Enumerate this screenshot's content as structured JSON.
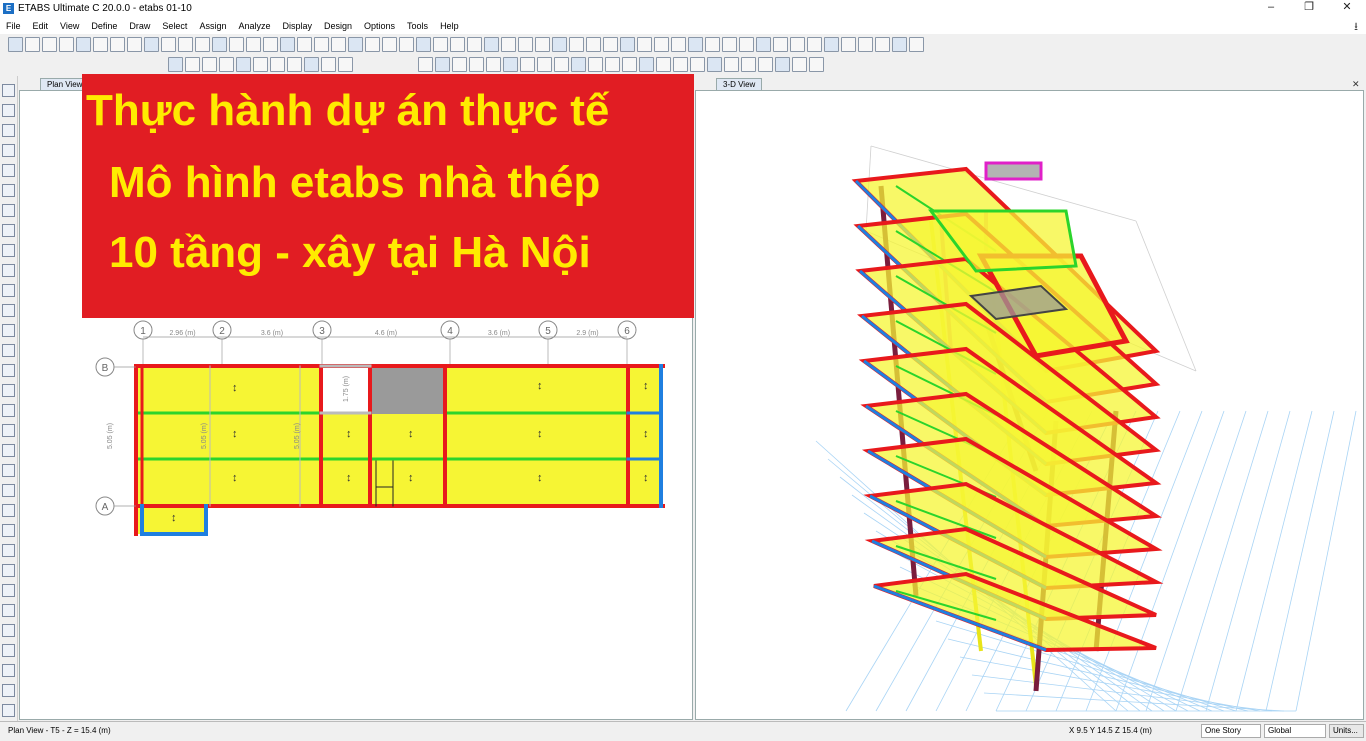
{
  "window": {
    "title": "ETABS Ultimate C 20.0.0 - etabs 01-10",
    "icon": "etabs-logo",
    "minimize": "–",
    "restore": "❐",
    "close": "✕"
  },
  "menu": [
    "File",
    "Edit",
    "View",
    "Define",
    "Draw",
    "Select",
    "Assign",
    "Analyze",
    "Display",
    "Design",
    "Options",
    "Tools",
    "Help"
  ],
  "download_icon": "⭳",
  "left_tab": "Plan View",
  "right_tab": "3-D View",
  "close_glyph": "✕",
  "banner": {
    "line1": "Thực hành dự án thực tế",
    "line2": "Mô hình etabs nhà thép",
    "line3": "10 tầng - xây tại Hà Nội"
  },
  "plan": {
    "grid_x": [
      "1",
      "2",
      "3",
      "4",
      "5",
      "6"
    ],
    "spacings": [
      "2.96 (m)",
      "3.6 (m)",
      "4.6 (m)",
      "3.6 (m)",
      "2.9 (m)"
    ],
    "grid_y": [
      "B",
      "A"
    ],
    "dim_vertical": "5.05 (m)",
    "dim_small": "1.75 (m)"
  },
  "status": {
    "left": "Plan View - T5 - Z = 15.4 (m)",
    "coords": "X 9.5  Y 14.5  Z 15.4 (m)",
    "story": "One Story",
    "coordsys": "Global",
    "units": "Units..."
  },
  "colors": {
    "banner": "#e11d23",
    "banner_text": "#ffeb00",
    "beam_red": "#e8191c",
    "beam_green": "#2bd42b",
    "slab_yellow": "#f6f534",
    "column_blue": "#1f7fe0"
  }
}
